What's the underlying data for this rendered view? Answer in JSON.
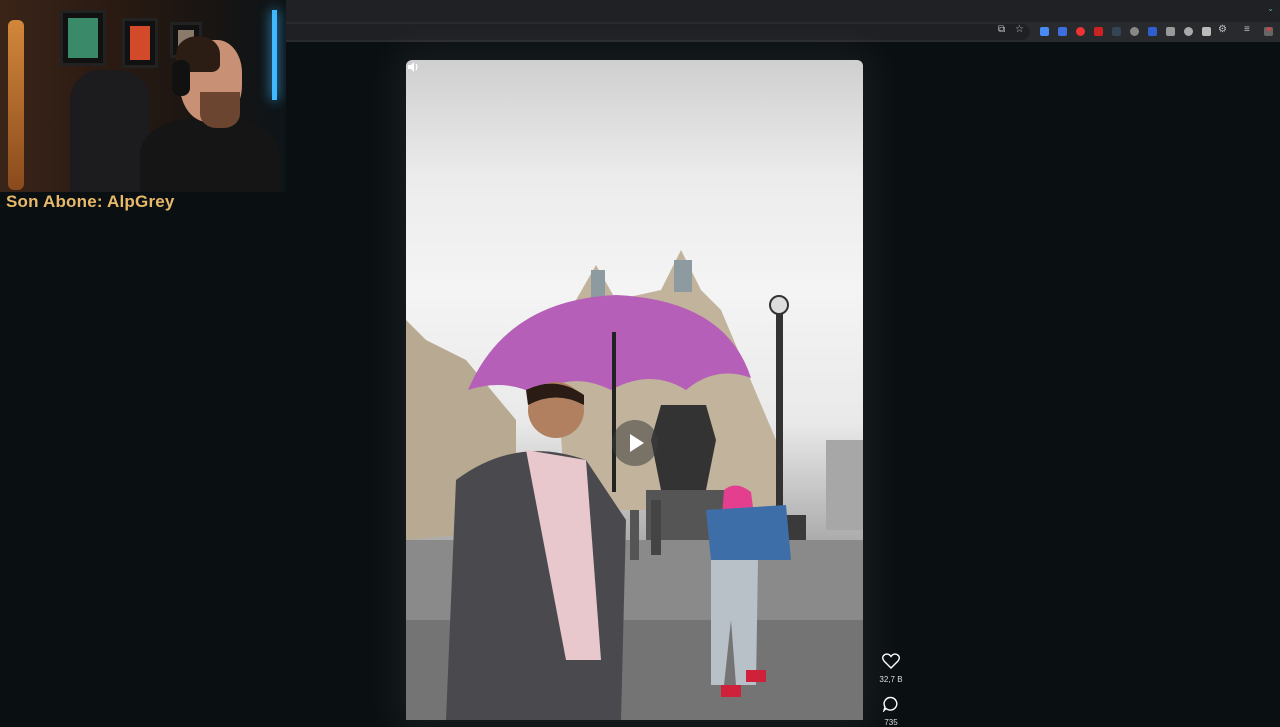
{
  "stream_overlay": {
    "last_subscriber": "Son Abone: AlpGrey"
  },
  "video": {
    "mute_icon": "speaker-icon",
    "play_icon": "play-icon"
  },
  "actions": {
    "like": {
      "icon": "heart-icon",
      "count": "32,7 B"
    },
    "comment": {
      "icon": "comment-icon",
      "count": "735"
    }
  },
  "colors": {
    "page_bg": "#0a0f12",
    "overlay_text": "#e8b96a",
    "umbrella": "#b65fb8"
  }
}
